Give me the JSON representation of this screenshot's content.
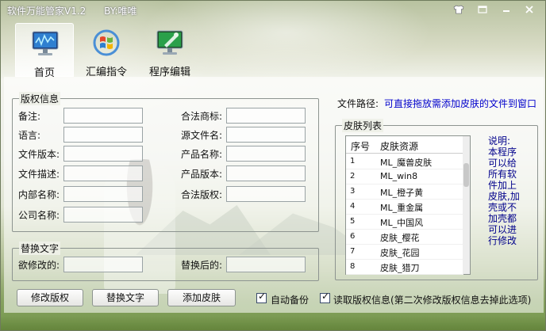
{
  "window": {
    "title": "软件万能管家V1.2      BY:唯唯",
    "controls": [
      "shirt-icon",
      "restore-icon",
      "minimize-icon",
      "close-icon"
    ]
  },
  "tabs": [
    {
      "label": "首页",
      "icon": "monitor-chart-icon",
      "active": true
    },
    {
      "label": "汇编指令",
      "icon": "windows-logo-icon",
      "active": false
    },
    {
      "label": "程序编辑",
      "icon": "monitor-edit-icon",
      "active": false
    }
  ],
  "copyright": {
    "legend": "版权信息",
    "left_fields": [
      {
        "label": "备注:",
        "value": ""
      },
      {
        "label": "语言:",
        "value": ""
      },
      {
        "label": "文件版本:",
        "value": ""
      },
      {
        "label": "文件描述:",
        "value": ""
      },
      {
        "label": "内部名称:",
        "value": ""
      },
      {
        "label": "公司名称:",
        "value": ""
      }
    ],
    "right_fields": [
      {
        "label": "合法商标:",
        "value": ""
      },
      {
        "label": "源文件名:",
        "value": ""
      },
      {
        "label": "产品名称:",
        "value": ""
      },
      {
        "label": "产品版本:",
        "value": ""
      },
      {
        "label": "合法版权:",
        "value": ""
      }
    ]
  },
  "replace": {
    "legend": "替换文字",
    "before_label": "欲修改的:",
    "before_value": "",
    "after_label": "替换后的:",
    "after_value": ""
  },
  "filepath": {
    "label": "文件路径:",
    "hint": "可直接拖放需添加皮肤的文件到窗口"
  },
  "skins": {
    "legend": "皮肤列表",
    "col_index": "序号",
    "col_name": "皮肤资源",
    "rows": [
      {
        "idx": "1",
        "name": "ML_魔兽皮肤"
      },
      {
        "idx": "2",
        "name": "ML_win8"
      },
      {
        "idx": "3",
        "name": "ML_橙子黄"
      },
      {
        "idx": "4",
        "name": "ML_重金属"
      },
      {
        "idx": "5",
        "name": "ML_中国风"
      },
      {
        "idx": "6",
        "name": "皮肤_樱花"
      },
      {
        "idx": "7",
        "name": "皮肤_花园"
      },
      {
        "idx": "8",
        "name": "皮肤_猎刀"
      }
    ]
  },
  "note": "说明:本程序可以给所有软件加上皮肤,加壳或不加壳都可以进行修改",
  "buttons": {
    "modify": "修改版权",
    "replace": "替换文字",
    "add_skin": "添加皮肤"
  },
  "checkboxes": {
    "auto_backup": "自动备份",
    "read_copyright": "读取版权信息(第二次修改版权信息去掉此选项)"
  },
  "colors": {
    "accent_text": "#00008b",
    "link_text": "#0000cc"
  }
}
